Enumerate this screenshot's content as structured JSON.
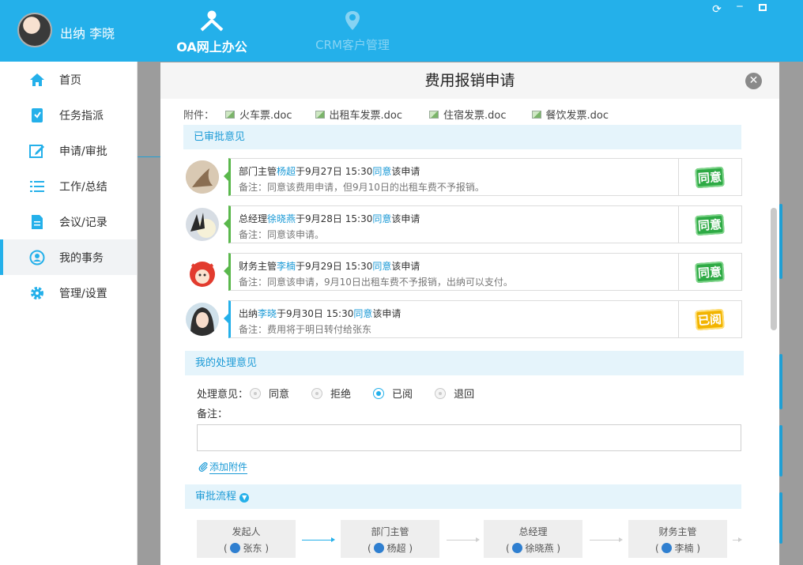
{
  "colors": {
    "brand": "#24b0ea",
    "approved": "#2eaa45",
    "read": "#f2b400",
    "link": "#1b9ad6"
  },
  "header": {
    "user": "出纳 李晓",
    "tabs": [
      {
        "label": "OA网上办公",
        "icon": "people-icon",
        "active": true
      },
      {
        "label": "CRM客户管理",
        "icon": "location-icon",
        "active": false
      }
    ]
  },
  "sidebar": {
    "items": [
      {
        "label": "首页",
        "icon": "home-icon"
      },
      {
        "label": "任务指派",
        "icon": "task-icon"
      },
      {
        "label": "申请/审批",
        "icon": "edit-icon"
      },
      {
        "label": "工作/总结",
        "icon": "list-icon"
      },
      {
        "label": "会议/记录",
        "icon": "document-icon"
      },
      {
        "label": "我的事务",
        "icon": "user-circle-icon",
        "active": true
      },
      {
        "label": "管理/设置",
        "icon": "gear-icon"
      }
    ]
  },
  "modal": {
    "title": "费用报销申请",
    "attachments_label": "附件：",
    "attachments": [
      "火车票.doc",
      "出租车发票.doc",
      "住宿发票.doc",
      "餐饮发票.doc"
    ],
    "approved_section": "已审批意见",
    "opinions": [
      {
        "role": "部门主管",
        "name": "杨超",
        "time": "于9月27日 15:30",
        "action": "同意",
        "suffix": "该申请",
        "note": "备注：同意该费用申请，但9月10日的出租车费不予报销。",
        "stamp": "同意"
      },
      {
        "role": "总经理",
        "name": "徐晓燕",
        "time": "于9月28日 15:30",
        "action": "同意",
        "suffix": "该申请",
        "note": "备注：同意该申请。",
        "stamp": "同意"
      },
      {
        "role": "财务主管",
        "name": "李楠",
        "time": "于9月29日 15:30",
        "action": "同意",
        "suffix": "该申请",
        "note": "备注：同意该申请，9月10日出租车费不予报销，出纳可以支付。",
        "stamp": "同意"
      },
      {
        "role": "出纳",
        "name": "李晓",
        "time": "于9月30日 15:30",
        "action": "同意",
        "suffix": "该申请",
        "note": "备注：费用将于明日转付给张东",
        "stamp": "已阅"
      }
    ],
    "my_section": "我的处理意见",
    "decision_label": "处理意见：",
    "decision_options": [
      {
        "label": "同意",
        "checked": false
      },
      {
        "label": "拒绝",
        "checked": false
      },
      {
        "label": "已阅",
        "checked": true
      },
      {
        "label": "退回",
        "checked": false
      }
    ],
    "note_label": "备注：",
    "note_value": "",
    "add_attachment": "添加附件",
    "flow_section": "审批流程",
    "flow": [
      {
        "role": "发起人",
        "person": "张东"
      },
      {
        "role": "部门主管",
        "person": "杨超"
      },
      {
        "role": "总经理",
        "person": "徐晓燕"
      },
      {
        "role": "财务主管",
        "person": "李楠"
      }
    ]
  }
}
